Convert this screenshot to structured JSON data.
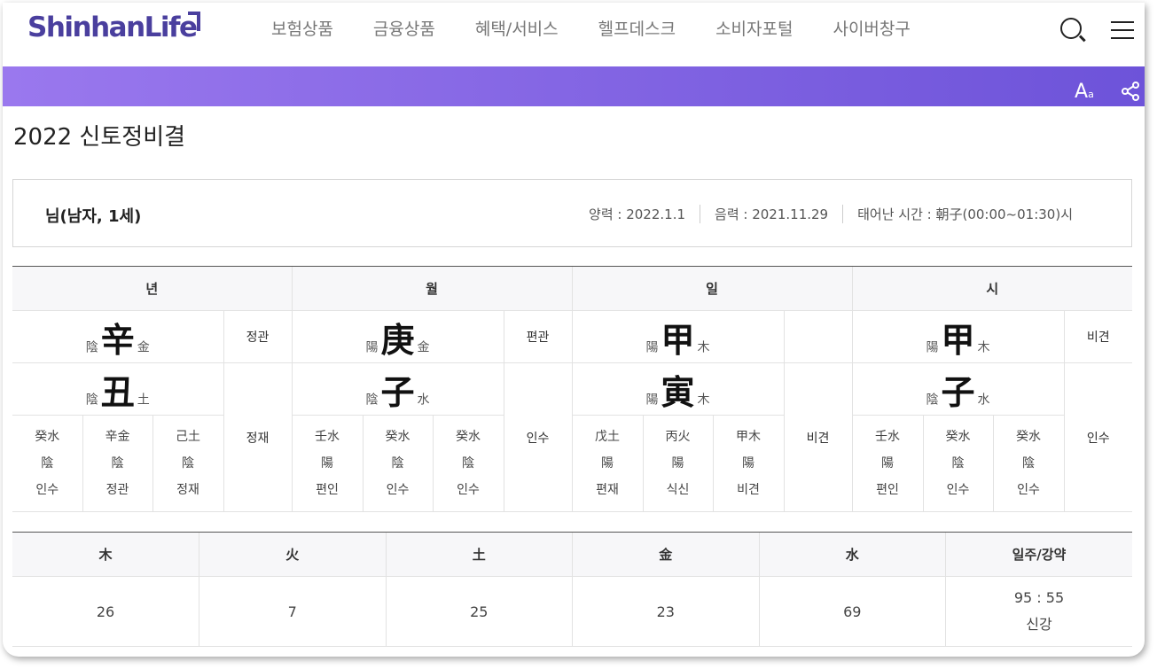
{
  "header": {
    "logo": "ShinhanLife",
    "nav": [
      "보험상품",
      "금융상품",
      "혜택/서비스",
      "헬프데스크",
      "소비자포털",
      "사이버창구"
    ],
    "icons": [
      "search-icon",
      "menu-icon"
    ]
  },
  "toolbar": {
    "font_size_label": "A",
    "font_size_sub": "a",
    "icons": [
      "font-size-icon",
      "share-icon"
    ]
  },
  "page": {
    "title": "2022 신토정비결"
  },
  "profile": {
    "name": "님(남자, 1세)",
    "solar": "양력 : 2022.1.1",
    "lunar": "음력 : 2021.11.29",
    "birth_time": "태어난 시간 : 朝子(00:00~01:30)시"
  },
  "saju": {
    "headers": [
      "년",
      "월",
      "일",
      "시"
    ],
    "pillars": [
      {
        "stem": {
          "yin": "陰",
          "char": "辛",
          "el": "金"
        },
        "stem_rel": "정관",
        "branch": {
          "yin": "陰",
          "char": "丑",
          "el": "土"
        },
        "branch_rel": "정재",
        "hidden": [
          {
            "c": "癸水",
            "y": "陰",
            "r": "인수"
          },
          {
            "c": "辛金",
            "y": "陰",
            "r": "정관"
          },
          {
            "c": "己土",
            "y": "陰",
            "r": "정재"
          }
        ]
      },
      {
        "stem": {
          "yin": "陽",
          "char": "庚",
          "el": "金"
        },
        "stem_rel": "편관",
        "branch": {
          "yin": "陰",
          "char": "子",
          "el": "水"
        },
        "branch_rel": "인수",
        "hidden": [
          {
            "c": "壬水",
            "y": "陽",
            "r": "편인"
          },
          {
            "c": "癸水",
            "y": "陰",
            "r": "인수"
          },
          {
            "c": "癸水",
            "y": "陰",
            "r": "인수"
          }
        ]
      },
      {
        "stem": {
          "yin": "陽",
          "char": "甲",
          "el": "木"
        },
        "stem_rel": "",
        "branch": {
          "yin": "陽",
          "char": "寅",
          "el": "木"
        },
        "branch_rel": "비견",
        "hidden": [
          {
            "c": "戊土",
            "y": "陽",
            "r": "편재"
          },
          {
            "c": "丙火",
            "y": "陽",
            "r": "식신"
          },
          {
            "c": "甲木",
            "y": "陽",
            "r": "비견"
          }
        ]
      },
      {
        "stem": {
          "yin": "陽",
          "char": "甲",
          "el": "木"
        },
        "stem_rel": "비견",
        "branch": {
          "yin": "陰",
          "char": "子",
          "el": "水"
        },
        "branch_rel": "인수",
        "hidden": [
          {
            "c": "壬水",
            "y": "陽",
            "r": "편인"
          },
          {
            "c": "癸水",
            "y": "陰",
            "r": "인수"
          },
          {
            "c": "癸水",
            "y": "陰",
            "r": "인수"
          }
        ]
      }
    ]
  },
  "ohang": {
    "headers": [
      "木",
      "火",
      "土",
      "金",
      "水",
      "일주/강약"
    ],
    "values": [
      "26",
      "7",
      "25",
      "23",
      "69"
    ],
    "strength_ratio": "95 : 55",
    "strength_label": "신강"
  }
}
